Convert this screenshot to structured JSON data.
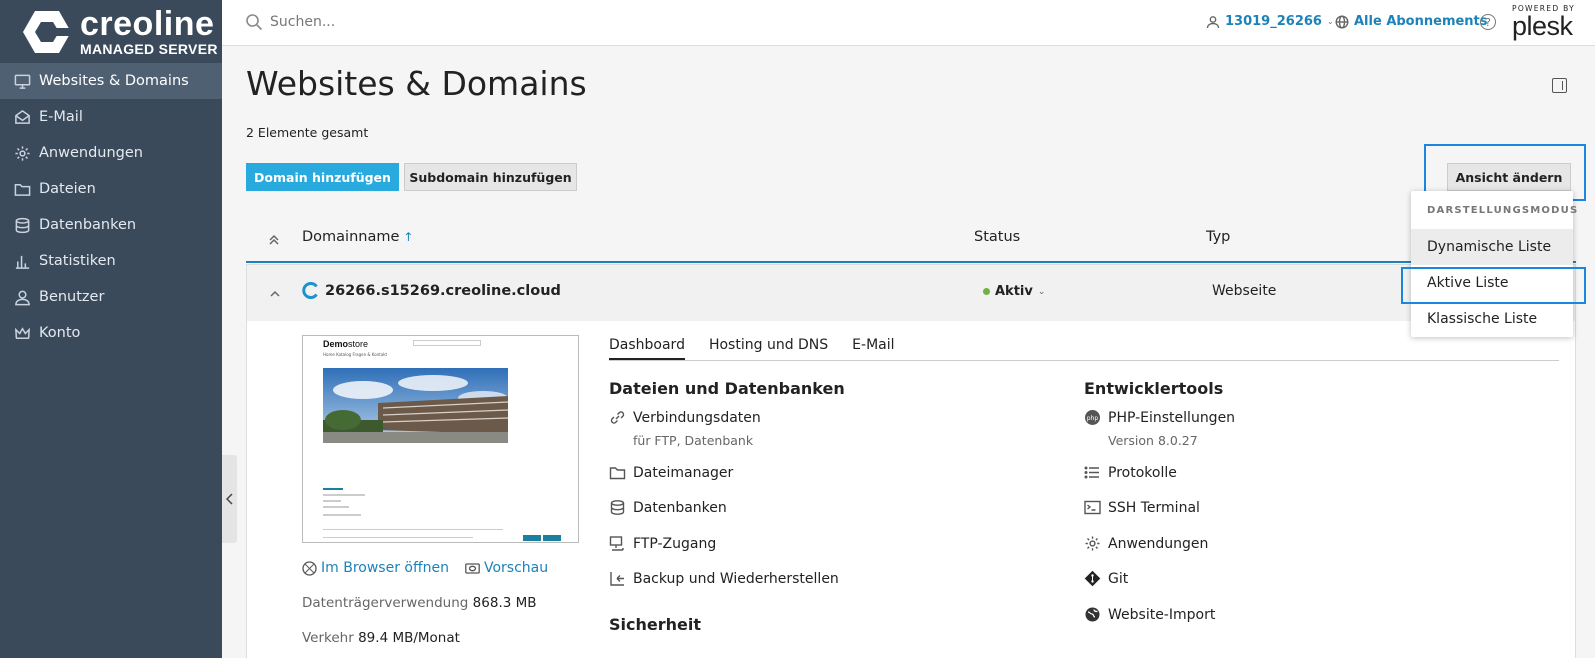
{
  "brand": {
    "name": "creoline",
    "sub": "MANAGED SERVER"
  },
  "sidebar": {
    "items": [
      {
        "label": "Websites & Domains",
        "icon": "monitor-icon",
        "active": true
      },
      {
        "label": "E-Mail",
        "icon": "mail-icon"
      },
      {
        "label": "Anwendungen",
        "icon": "gear-icon"
      },
      {
        "label": "Dateien",
        "icon": "folder-icon"
      },
      {
        "label": "Datenbanken",
        "icon": "database-icon"
      },
      {
        "label": "Statistiken",
        "icon": "bar-chart-icon"
      },
      {
        "label": "Benutzer",
        "icon": "user-icon"
      },
      {
        "label": "Konto",
        "icon": "crown-icon"
      }
    ]
  },
  "topbar": {
    "search_placeholder": "Suchen...",
    "user": "13019_26266",
    "subscriptions": "Alle Abonnements",
    "help": "?",
    "powered_by": "POWERED BY",
    "plesk": "plesk"
  },
  "page": {
    "title": "Websites & Domains",
    "count": "2 Elemente gesamt",
    "add_domain": "Domain hinzufügen",
    "add_subdomain": "Subdomain hinzufügen",
    "change_view": "Ansicht ändern"
  },
  "view_menu": {
    "heading": "DARSTELLUNGSMODUS",
    "options": [
      "Dynamische Liste",
      "Aktive Liste",
      "Klassische Liste"
    ]
  },
  "list": {
    "col_domain": "Domainname",
    "sort_arrow": "↑",
    "col_status": "Status",
    "col_type": "Typ"
  },
  "domain": {
    "name": "26266.s15269.creoline.cloud",
    "status": "Aktiv",
    "type": "Webseite",
    "preview_logo_bold": "Demo",
    "preview_logo_rest": "store",
    "preview_nav": "Home   Katalog   Fragen & Kontakt",
    "open_browser": "Im Browser öffnen",
    "preview_link": "Vorschau",
    "disk_label": "Datenträgerverwendung",
    "disk_value": "868.3 MB",
    "traffic_label": "Verkehr",
    "traffic_value": "89.4 MB/Monat"
  },
  "tabs": [
    "Dashboard",
    "Hosting und DNS",
    "E-Mail"
  ],
  "sections": {
    "files": {
      "title": "Dateien und Datenbanken",
      "items": [
        {
          "label": "Verbindungsdaten",
          "sub": "für FTP, Datenbank",
          "icon": "link-icon"
        },
        {
          "label": "Dateimanager",
          "icon": "folder-icon"
        },
        {
          "label": "Datenbanken",
          "icon": "database-icon"
        },
        {
          "label": "FTP-Zugang",
          "icon": "ftp-icon"
        },
        {
          "label": "Backup und Wiederherstellen",
          "icon": "backup-icon"
        }
      ]
    },
    "security": {
      "title": "Sicherheit"
    },
    "dev": {
      "title": "Entwicklertools",
      "items": [
        {
          "label": "PHP-Einstellungen",
          "sub": "Version 8.0.27",
          "icon": "php-icon"
        },
        {
          "label": "Protokolle",
          "icon": "list-icon"
        },
        {
          "label": "SSH Terminal",
          "icon": "terminal-icon"
        },
        {
          "label": "Anwendungen",
          "icon": "gear-icon"
        },
        {
          "label": "Git",
          "icon": "git-icon"
        },
        {
          "label": "Website-Import",
          "icon": "globe-import-icon"
        }
      ]
    }
  },
  "colors": {
    "sidebar": "#3a4a5b",
    "accent": "#28aade",
    "link": "#1d82b8",
    "highlight": "#1a86e0",
    "status_active": "#6cb33f"
  }
}
